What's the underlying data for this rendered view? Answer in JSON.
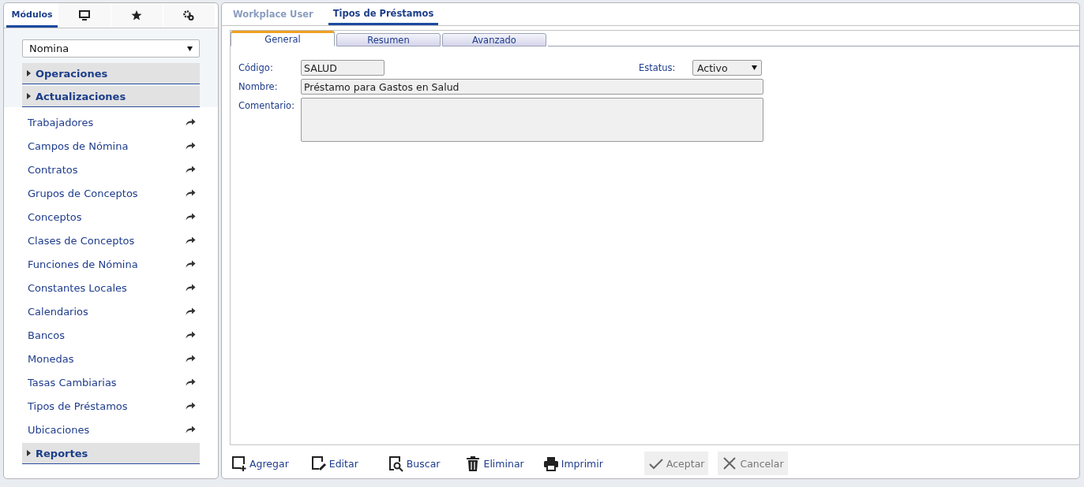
{
  "sidebar": {
    "tabs": [
      {
        "kind": "text",
        "label": "Módulos",
        "selected": true
      },
      {
        "kind": "monitor",
        "selected": false
      },
      {
        "kind": "star",
        "selected": false
      },
      {
        "kind": "gears",
        "selected": false
      }
    ],
    "module_select": {
      "value": "Nomina"
    },
    "sections": [
      {
        "label": "Operaciones"
      },
      {
        "label": "Actualizaciones",
        "items": [
          "Trabajadores",
          "Campos de Nómina",
          "Contratos",
          "Grupos de Conceptos",
          "Conceptos",
          "Clases de Conceptos",
          "Funciones de Nómina",
          "Constantes Locales",
          "Calendarios",
          "Bancos",
          "Monedas",
          "Tasas Cambiarias",
          "Tipos de Préstamos",
          "Ubicaciones"
        ]
      },
      {
        "label": "Reportes"
      }
    ]
  },
  "top_tabs": [
    {
      "label": "Workplace User",
      "selected": false
    },
    {
      "label": "Tipos de Préstamos",
      "selected": true
    }
  ],
  "form_tabs": [
    {
      "label": "General",
      "selected": true
    },
    {
      "label": "Resumen",
      "selected": false
    },
    {
      "label": "Avanzado",
      "selected": false
    }
  ],
  "form": {
    "codigo": {
      "label": "Código:",
      "value": "SALUD"
    },
    "estatus": {
      "label": "Estatus:",
      "value": "Activo"
    },
    "nombre": {
      "label": "Nombre:",
      "value": "Préstamo para Gastos en Salud"
    },
    "comentario": {
      "label": "Comentario:"
    }
  },
  "toolbar": [
    {
      "kind": "add",
      "label": "Agregar",
      "disabled": false
    },
    {
      "kind": "edit",
      "label": "Editar",
      "disabled": false
    },
    {
      "kind": "search",
      "label": "Buscar",
      "disabled": false
    },
    {
      "kind": "delete",
      "label": "Eliminar",
      "disabled": false
    },
    {
      "kind": "print",
      "label": "Imprimir",
      "disabled": false
    },
    {
      "kind": "accept",
      "label": "Aceptar",
      "disabled": true
    },
    {
      "kind": "cancel",
      "label": "Cancelar",
      "disabled": true
    }
  ]
}
